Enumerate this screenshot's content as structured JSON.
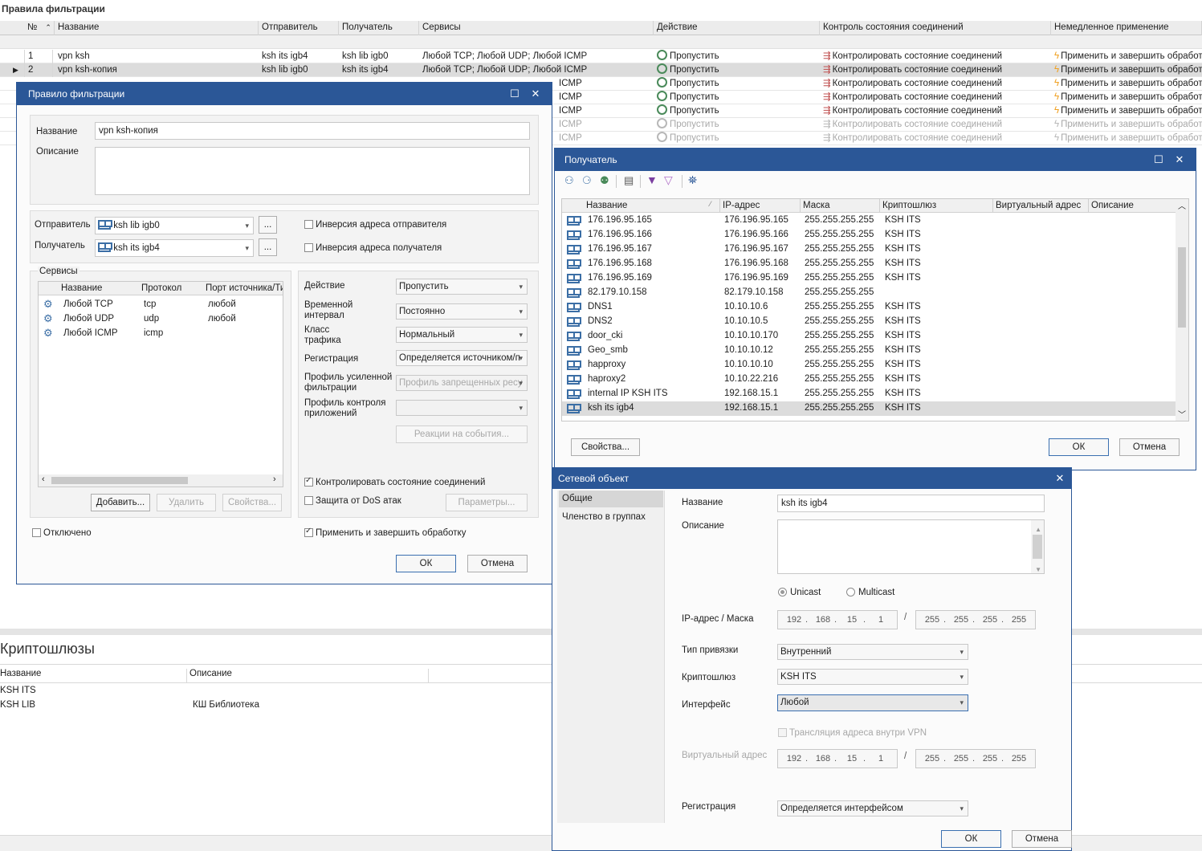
{
  "main": {
    "title": "Правила фильтрации",
    "columns": [
      "№",
      "Название",
      "Отправитель",
      "Получатель",
      "Сервисы",
      "Действие",
      "Контроль состояния соединений",
      "Немедленное применение"
    ],
    "rows": [
      {
        "num": "1",
        "name": "vpn ksh",
        "sender": "ksh its igb4",
        "receiver": "ksh lib igb0",
        "services": "Любой TCP; Любой UDP; Любой ICMP",
        "action": "Пропустить",
        "state": "Контролировать состояние соединений",
        "apply": "Применить и завершить обработку"
      },
      {
        "num": "2",
        "name": "vpn ksh-копия",
        "sender": "ksh lib igb0",
        "receiver": "ksh its igb4",
        "services": "Любой TCP; Любой UDP; Любой ICMP",
        "action": "Пропустить",
        "state": "Контролировать состояние соединений",
        "apply": "Применить и завершить обработку"
      },
      {
        "services": "ICMP",
        "action": "Пропустить",
        "state": "Контролировать состояние соединений",
        "apply": "Применить и завершить обработку"
      },
      {
        "services": "ICMP",
        "action": "Пропустить",
        "state": "Контролировать состояние соединений",
        "apply": "Применить и завершить обработку"
      },
      {
        "services": "ICMP",
        "action": "Пропустить",
        "state": "Контролировать состояние соединений",
        "apply": "Применить и завершить обработку"
      },
      {
        "services": "ICMP",
        "action": "Пропустить",
        "state": "Контролировать состояние соединений",
        "apply": "Применить и завершить обработку"
      },
      {
        "services": "ICMP",
        "action": "Пропустить",
        "state": "Контролировать состояние соединений",
        "apply": "Применить и завершить обработку"
      }
    ]
  },
  "crypto": {
    "title": "Криптошлюзы",
    "columns": [
      "Название",
      "Описание"
    ],
    "rows": [
      {
        "name": "KSH ITS",
        "desc": ""
      },
      {
        "name": "KSH LIB",
        "desc": "КШ Библиотека"
      }
    ]
  },
  "rule_dialog": {
    "title": "Правило фильтрации",
    "name_label": "Название",
    "name_value": "vpn ksh-копия",
    "desc_label": "Описание",
    "sender_label": "Отправитель",
    "sender_value": "ksh lib igb0",
    "receiver_label": "Получатель",
    "receiver_value": "ksh its igb4",
    "browse": "...",
    "invert_sender": "Инверсия адреса отправителя",
    "invert_receiver": "Инверсия адреса получателя",
    "services_label": "Сервисы",
    "svc_columns": [
      "Название",
      "Протокол",
      "Порт источника/Ти"
    ],
    "services": [
      {
        "name": "Любой TCP",
        "proto": "tcp",
        "port": "любой"
      },
      {
        "name": "Любой UDP",
        "proto": "udp",
        "port": "любой"
      },
      {
        "name": "Любой ICMP",
        "proto": "icmp",
        "port": ""
      }
    ],
    "add": "Добавить...",
    "delete": "Удалить",
    "props": "Свойства...",
    "action_label": "Действие",
    "action_value": "Пропустить",
    "interval_label": "Временной интервал",
    "interval_value": "Постоянно",
    "class_label": "Класс трафика",
    "class_value": "Нормальный",
    "reg_label": "Регистрация",
    "reg_value": "Определяется источником/п",
    "filter_profile_label": "Профиль усиленной фильтрации",
    "filter_profile_value": "Профиль запрещенных ресу",
    "app_profile_label": "Профиль контроля приложений",
    "reactions": "Реакции на события...",
    "stateful": "Контролировать состояние соединений",
    "dos": "Защита от DoS атак",
    "params": "Параметры...",
    "disabled": "Отключено",
    "apply_finish": "Применить и завершить обработку",
    "ok": "ОК",
    "cancel": "Отмена"
  },
  "receiver_dialog": {
    "title": "Получатель",
    "columns": [
      "Название",
      "IP-адрес",
      "Маска",
      "Криптошлюз",
      "Виртуальный адрес",
      "Описание"
    ],
    "rows": [
      {
        "name": "176.196.95.165",
        "ip": "176.196.95.165",
        "mask": "255.255.255.255",
        "gw": "KSH ITS"
      },
      {
        "name": "176.196.95.166",
        "ip": "176.196.95.166",
        "mask": "255.255.255.255",
        "gw": "KSH ITS"
      },
      {
        "name": "176.196.95.167",
        "ip": "176.196.95.167",
        "mask": "255.255.255.255",
        "gw": "KSH ITS"
      },
      {
        "name": "176.196.95.168",
        "ip": "176.196.95.168",
        "mask": "255.255.255.255",
        "gw": "KSH ITS"
      },
      {
        "name": "176.196.95.169",
        "ip": "176.196.95.169",
        "mask": "255.255.255.255",
        "gw": "KSH ITS"
      },
      {
        "name": "82.179.10.158",
        "ip": "82.179.10.158",
        "mask": "255.255.255.255",
        "gw": ""
      },
      {
        "name": "DNS1",
        "ip": "10.10.10.6",
        "mask": "255.255.255.255",
        "gw": "KSH ITS"
      },
      {
        "name": "DNS2",
        "ip": "10.10.10.5",
        "mask": "255.255.255.255",
        "gw": "KSH ITS"
      },
      {
        "name": "door_cki",
        "ip": "10.10.10.170",
        "mask": "255.255.255.255",
        "gw": "KSH ITS"
      },
      {
        "name": "Geo_smb",
        "ip": "10.10.10.12",
        "mask": "255.255.255.255",
        "gw": "KSH ITS"
      },
      {
        "name": "happroxy",
        "ip": "10.10.10.10",
        "mask": "255.255.255.255",
        "gw": "KSH ITS"
      },
      {
        "name": "haproxy2",
        "ip": "10.10.22.216",
        "mask": "255.255.255.255",
        "gw": "KSH ITS"
      },
      {
        "name": "internal IP KSH ITS",
        "ip": "192.168.15.1",
        "mask": "255.255.255.255",
        "gw": "KSH ITS"
      },
      {
        "name": "ksh its igb4",
        "ip": "192.168.15.1",
        "mask": "255.255.255.255",
        "gw": "KSH ITS"
      }
    ],
    "props": "Свойства...",
    "ok": "ОК",
    "cancel": "Отмена"
  },
  "netobj_dialog": {
    "title": "Сетевой объект",
    "nav": [
      "Общие",
      "Членство в группах"
    ],
    "name_label": "Название",
    "name_value": "ksh its igb4",
    "desc_label": "Описание",
    "unicast": "Unicast",
    "multicast": "Multicast",
    "ip_label": "IP-адрес / Маска",
    "ip": [
      "192",
      "168",
      "15",
      "1"
    ],
    "mask": [
      "255",
      "255",
      "255",
      "255"
    ],
    "bind_label": "Тип привязки",
    "bind_value": "Внутренний",
    "gw_label": "Криптошлюз",
    "gw_value": "KSH ITS",
    "iface_label": "Интерфейс",
    "iface_value": "Любой",
    "nat_vpn": "Трансляция адреса внутри VPN",
    "virt_label": "Виртуальный адрес",
    "virt_ip": [
      "192",
      "168",
      "15",
      "1"
    ],
    "virt_mask": [
      "255",
      "255",
      "255",
      "255"
    ],
    "reg_label": "Регистрация",
    "reg_value": "Определяется интерфейсом",
    "ok": "ОК",
    "cancel": "Отмена"
  },
  "colors": {
    "titlebar": "#2b5797",
    "lightning": "#f0a020",
    "icon_blue": "#3b6ea5"
  }
}
